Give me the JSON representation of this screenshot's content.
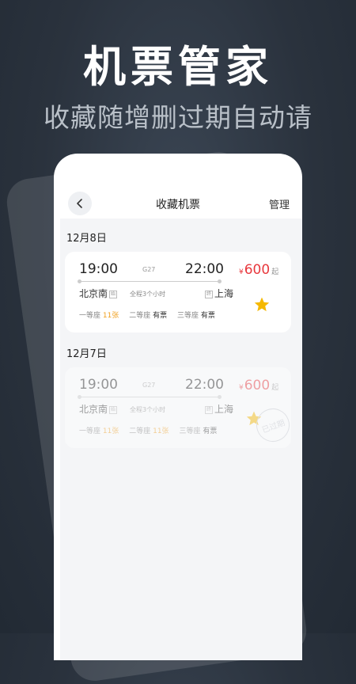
{
  "headline": "机票管家",
  "subheadline": "收藏随增删过期自动请",
  "nav": {
    "title": "收藏机票",
    "manage": "管理"
  },
  "groups": [
    {
      "date": "12月8日",
      "ticket": {
        "depart_time": "19:00",
        "arrive_time": "22:00",
        "train_no": "G27",
        "from": "北京南",
        "from_tag": "始",
        "to": "上海",
        "to_tag": "终",
        "duration": "全程3个小时",
        "price_symbol": "¥",
        "price": "600",
        "price_suffix": "起",
        "seats": [
          {
            "name": "一等座",
            "avail": "11张"
          },
          {
            "name": "二等座",
            "avail": "有票"
          },
          {
            "name": "三等座",
            "avail": "有票"
          }
        ],
        "expired": false
      }
    },
    {
      "date": "12月7日",
      "ticket": {
        "depart_time": "19:00",
        "arrive_time": "22:00",
        "train_no": "G27",
        "from": "北京南",
        "from_tag": "始",
        "to": "上海",
        "to_tag": "终",
        "duration": "全程3个小时",
        "price_symbol": "¥",
        "price": "600",
        "price_suffix": "起",
        "seats": [
          {
            "name": "一等座",
            "avail": "11张"
          },
          {
            "name": "二等座",
            "avail": "11张"
          },
          {
            "name": "三等座",
            "avail": "有票"
          }
        ],
        "expired": true,
        "expired_label": "已过期"
      }
    }
  ],
  "colors": {
    "price": "#e8383d",
    "star": "#f5b800",
    "warn": "#f0a020"
  }
}
